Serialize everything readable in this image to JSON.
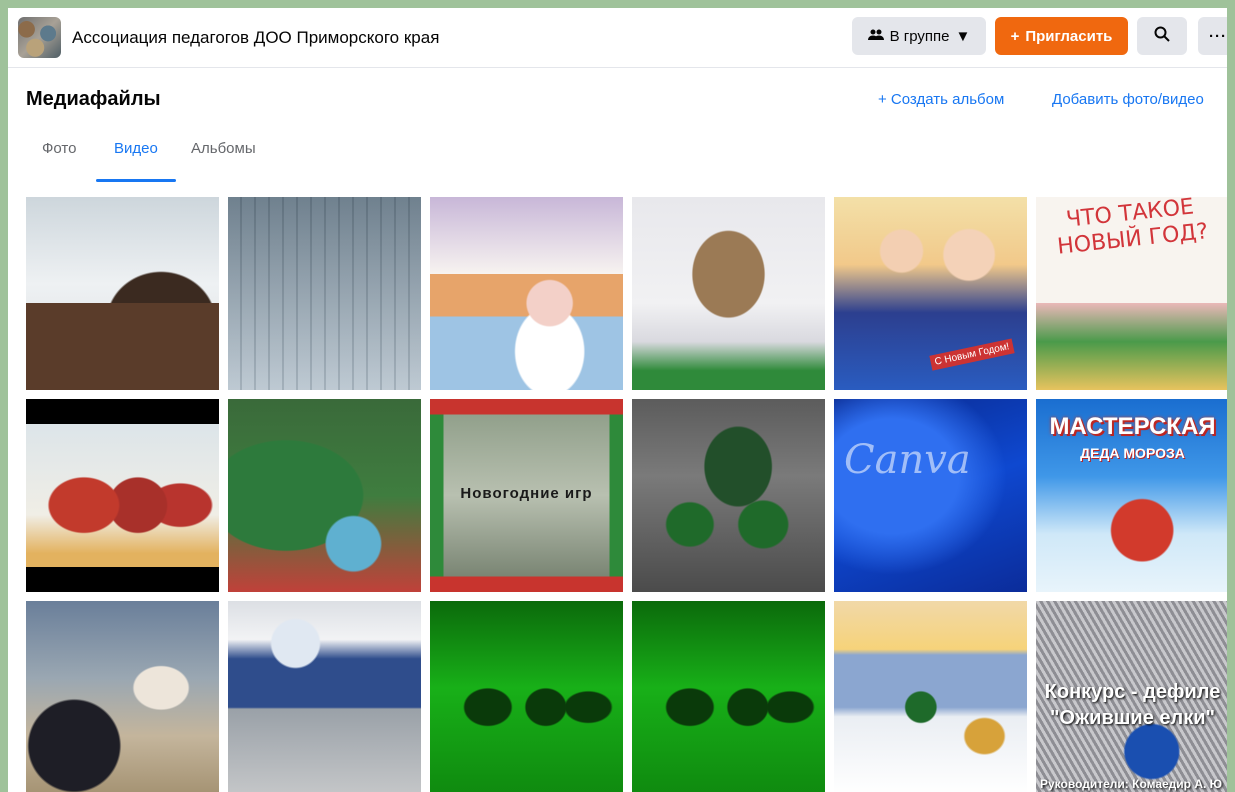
{
  "header": {
    "group_name": "Ассоциация педагогов ДОО Приморского края",
    "in_group_label": "В группе",
    "invite_label": "Пригласить",
    "more_label": "···"
  },
  "section": {
    "title": "Медиафайлы",
    "create_album_label": "+ Создать альбом",
    "add_media_label": "Добавить фото/видео"
  },
  "tabs": [
    {
      "label": "Фото",
      "active": false
    },
    {
      "label": "Видео",
      "active": true
    },
    {
      "label": "Альбомы",
      "active": false
    }
  ],
  "media": {
    "tile6_text": "ЧТО ТАКОЕ НОВЫЙ ГОД?",
    "tile5_text": "С Новым Годом!",
    "tile9_text": "Новогодние игр",
    "tile11_text": "Canva",
    "tile12_title": "МАСТЕРСКАЯ",
    "tile12_sub": "ДЕДА МОРОЗА",
    "tile18_title": "Конкурс - дефиле \"Ожившие елки\"",
    "tile18_footer": "Руководители: Комаедир А. Ю"
  },
  "colors": {
    "accent": "#1877f2",
    "invite": "#f0680f",
    "frame": "#9fc29a"
  }
}
